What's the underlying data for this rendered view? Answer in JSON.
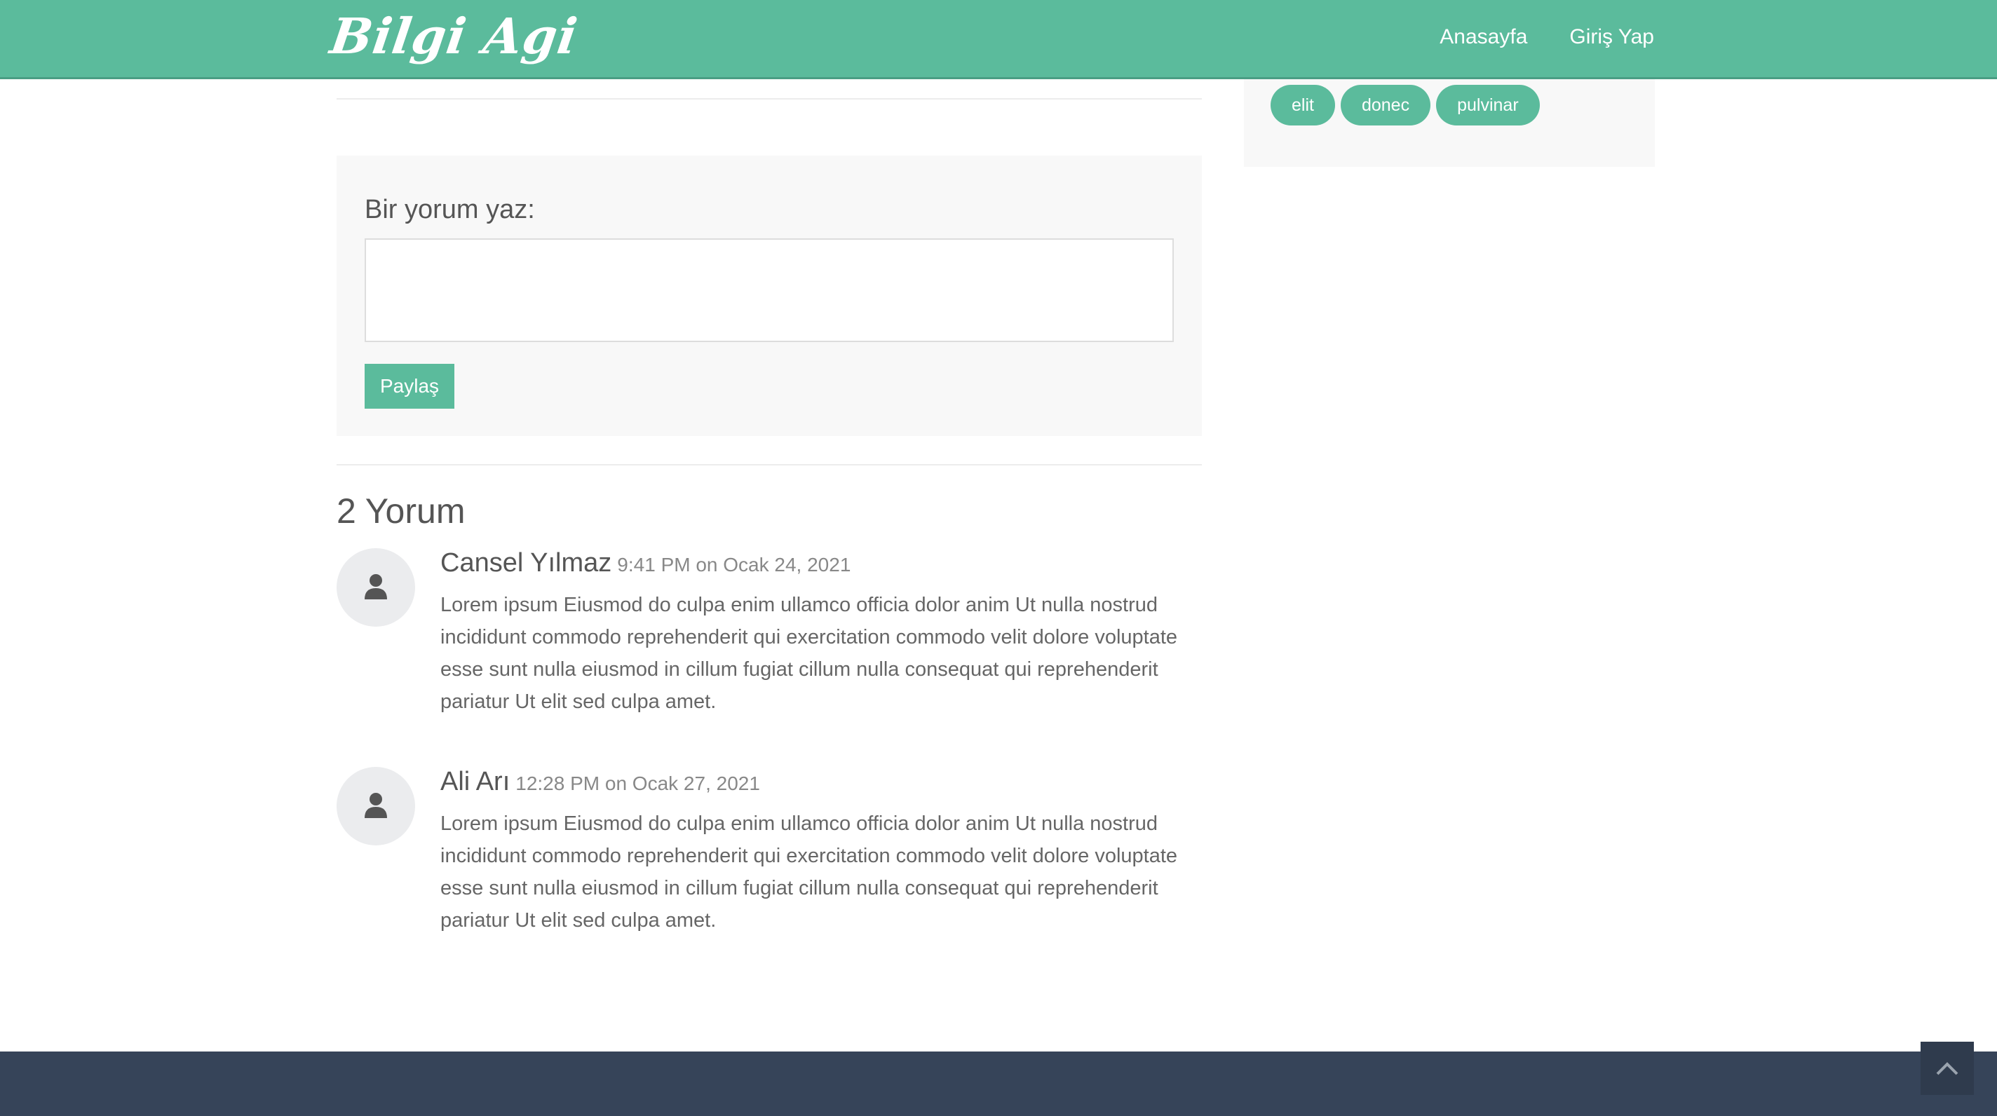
{
  "header": {
    "logo": "Bilgi Agi",
    "nav": [
      "Anasayfa",
      "Giriş Yap"
    ]
  },
  "comment_form": {
    "label": "Bir yorum yaz:",
    "textarea_value": "",
    "submit_label": "Paylaş"
  },
  "comments": {
    "count_label": "2 Yorum",
    "items": [
      {
        "author": "Cansel Yılmaz",
        "date": "9:41 PM on Ocak 24, 2021",
        "text": "Lorem ipsum Eiusmod do culpa enim ullamco officia dolor anim Ut nulla nostrud incididunt commodo reprehenderit qui exercitation commodo velit dolore voluptate esse sunt nulla eiusmod in cillum fugiat cillum nulla consequat qui reprehenderit pariatur Ut elit sed culpa amet."
      },
      {
        "author": "Ali Arı",
        "date": "12:28 PM on Ocak 27, 2021",
        "text": "Lorem ipsum Eiusmod do culpa enim ullamco officia dolor anim Ut nulla nostrud incididunt commodo reprehenderit qui exercitation commodo velit dolore voluptate esse sunt nulla eiusmod in cillum fugiat cillum nulla consequat qui reprehenderit pariatur Ut elit sed culpa amet."
      }
    ]
  },
  "sidebar": {
    "tags": [
      "elit",
      "donec",
      "pulvinar"
    ]
  },
  "icons": {
    "avatar": "user-icon",
    "scroll_top": "chevron-up-icon"
  },
  "colors": {
    "accent": "#5bbb9c",
    "footer": "#364459"
  }
}
